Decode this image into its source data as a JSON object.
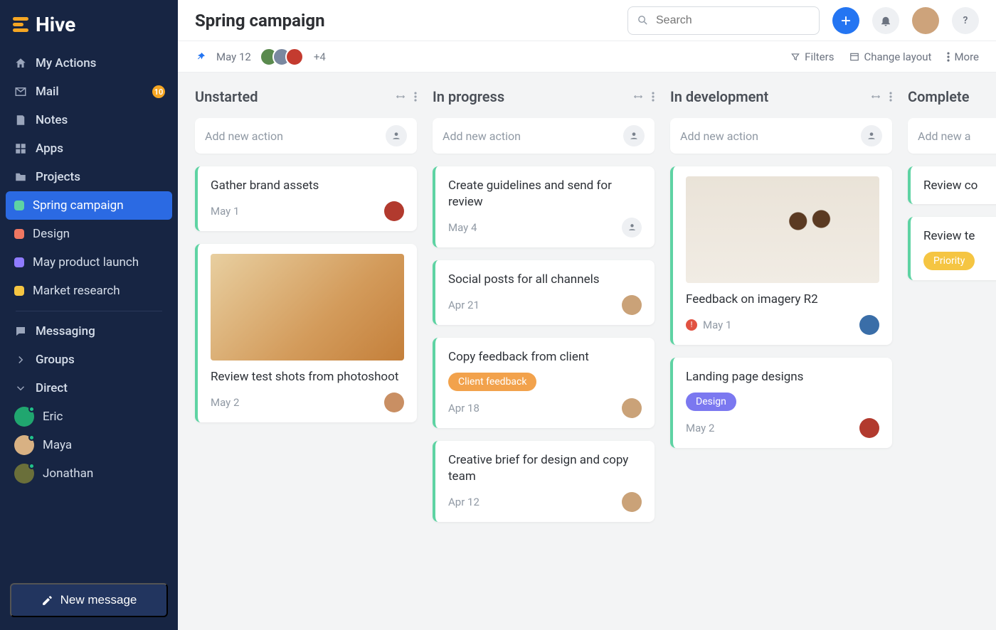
{
  "app": {
    "name": "Hive"
  },
  "sidebar": {
    "top": [
      {
        "icon": "home",
        "label": "My Actions"
      },
      {
        "icon": "mail",
        "label": "Mail",
        "badge": "10"
      },
      {
        "icon": "notes",
        "label": "Notes"
      },
      {
        "icon": "apps",
        "label": "Apps"
      },
      {
        "icon": "folder",
        "label": "Projects"
      }
    ],
    "projects": [
      {
        "color": "#5ed3a3",
        "label": "Spring campaign",
        "active": true
      },
      {
        "color": "#ef7762",
        "label": "Design"
      },
      {
        "color": "#8f7bff",
        "label": "May product launch"
      },
      {
        "color": "#f5c542",
        "label": "Market research"
      }
    ],
    "messaging_label": "Messaging",
    "groups_label": "Groups",
    "direct_label": "Direct",
    "direct": [
      {
        "label": "Eric",
        "bg": "#20a66f"
      },
      {
        "label": "Maya",
        "bg": "#d8b183"
      },
      {
        "label": "Jonathan",
        "bg": "#6a6f3a"
      }
    ],
    "new_message": "New message"
  },
  "header": {
    "title": "Spring campaign",
    "search_placeholder": "Search"
  },
  "subbar": {
    "date": "May 12",
    "more_count": "+4",
    "filters": "Filters",
    "layout": "Change layout",
    "more": "More"
  },
  "board": {
    "add_placeholder": "Add new action",
    "columns": [
      {
        "title": "Unstarted",
        "cards": [
          {
            "title": "Gather brand assets",
            "date": "May 1",
            "avatar_bg": "#b23a2e"
          },
          {
            "image": "sunglasses",
            "title": "Review test shots from photoshoot",
            "date": "May 2",
            "avatar_bg": "#c98f63"
          }
        ]
      },
      {
        "title": "In progress",
        "cards": [
          {
            "title": "Create guidelines and send for review",
            "date": "May 4",
            "avatar": "none"
          },
          {
            "title": "Social posts for all channels",
            "date": "Apr 21",
            "avatar_bg": "#caa278"
          },
          {
            "title": "Copy feedback from client",
            "tag": {
              "text": "Client feedback",
              "style": "orange"
            },
            "date": "Apr 18",
            "avatar_bg": "#caa278"
          },
          {
            "title": "Creative brief for design and copy team",
            "date": "Apr 12",
            "avatar_bg": "#caa278"
          }
        ]
      },
      {
        "title": "In development",
        "cards": [
          {
            "image": "flatlay",
            "title": "Feedback on imagery R2",
            "date": "May 1",
            "alert": true,
            "avatar_bg": "#3a6ea8"
          },
          {
            "title": "Landing page designs",
            "tag": {
              "text": "Design",
              "style": "purple"
            },
            "date": "May 2",
            "avatar_bg": "#b23a2e"
          }
        ]
      },
      {
        "title": "Complete",
        "partial": true,
        "add_placeholder": "Add new a",
        "cards": [
          {
            "title": "Review co"
          },
          {
            "title": "Review te",
            "tag": {
              "text": "Priority",
              "style": "yellow"
            }
          }
        ]
      }
    ]
  }
}
